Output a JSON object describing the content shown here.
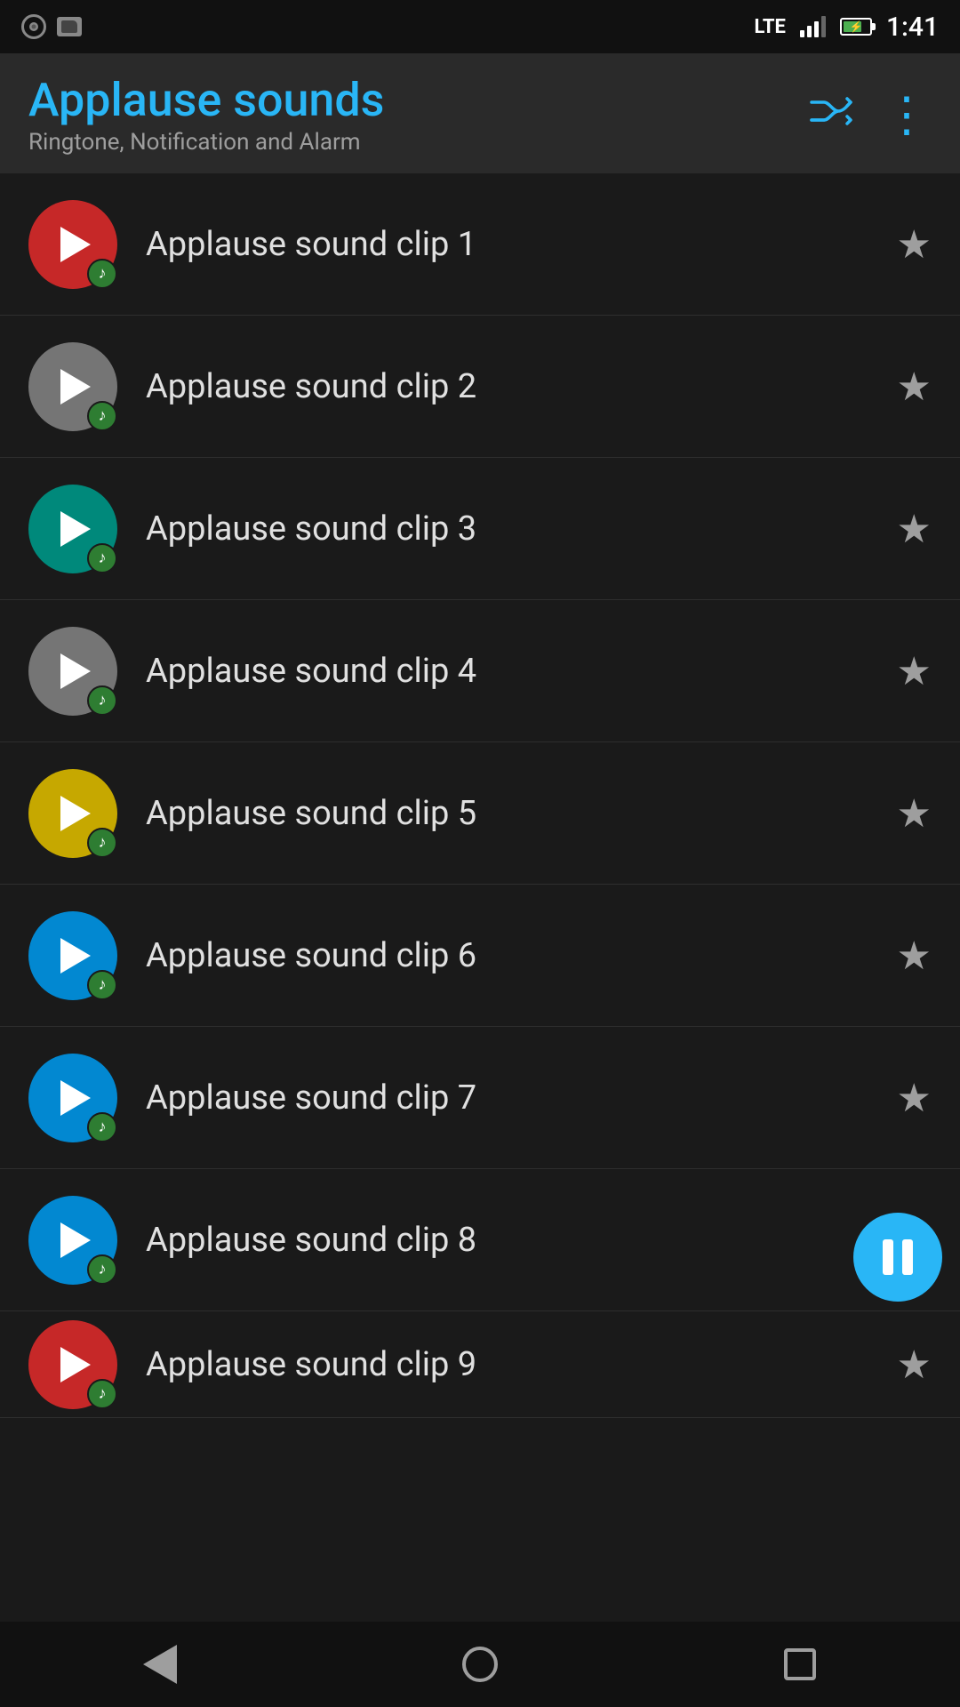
{
  "statusBar": {
    "time": "1:41",
    "battery": "70",
    "signal": "lte"
  },
  "toolbar": {
    "title": "Applause sounds",
    "subtitle": "Ringtone, Notification and Alarm",
    "shuffleLabel": "shuffle",
    "moreLabel": "more options"
  },
  "clips": [
    {
      "id": 1,
      "name": "Applause sound clip 1",
      "color": "color-red",
      "starred": false,
      "playing": false
    },
    {
      "id": 2,
      "name": "Applause sound clip 2",
      "color": "color-gray",
      "starred": false,
      "playing": false
    },
    {
      "id": 3,
      "name": "Applause sound clip 3",
      "color": "color-teal",
      "starred": false,
      "playing": false
    },
    {
      "id": 4,
      "name": "Applause sound clip 4",
      "color": "color-gray2",
      "starred": false,
      "playing": false
    },
    {
      "id": 5,
      "name": "Applause sound clip 5",
      "color": "color-yellow",
      "starred": false,
      "playing": false
    },
    {
      "id": 6,
      "name": "Applause sound clip 6",
      "color": "color-cyan",
      "starred": false,
      "playing": false
    },
    {
      "id": 7,
      "name": "Applause sound clip 7",
      "color": "color-cyan2",
      "starred": false,
      "playing": false
    },
    {
      "id": 8,
      "name": "Applause sound clip 8",
      "color": "color-cyan3",
      "starred": false,
      "playing": true
    },
    {
      "id": 9,
      "name": "Applause sound clip 9",
      "color": "color-red2",
      "starred": false,
      "playing": false
    }
  ],
  "pauseFab": {
    "visible": true,
    "label": "pause"
  },
  "bottomNav": {
    "back": "back",
    "home": "home",
    "recents": "recents"
  }
}
